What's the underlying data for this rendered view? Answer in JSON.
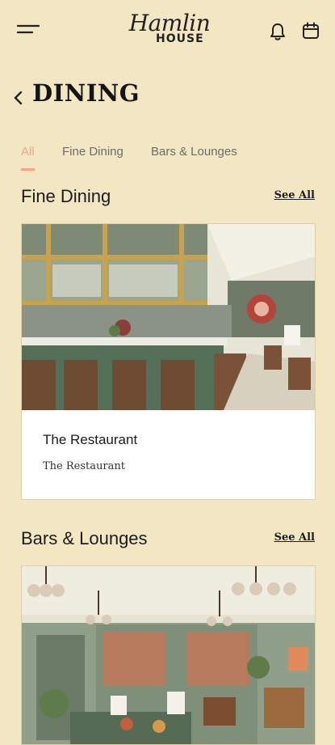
{
  "header": {
    "logo_script": "Hamlin",
    "logo_caps": "HOUSE"
  },
  "page": {
    "title": "DINING"
  },
  "tabs": [
    {
      "label": "All",
      "active": true
    },
    {
      "label": "Fine Dining",
      "active": false
    },
    {
      "label": "Bars & Lounges",
      "active": false
    }
  ],
  "sections": [
    {
      "title": "Fine Dining",
      "see_all": "See All",
      "cards": [
        {
          "title": "The Restaurant",
          "subtitle": "The Restaurant"
        }
      ]
    },
    {
      "title": "Bars & Lounges",
      "see_all": "See All"
    }
  ],
  "colors": {
    "background": "#f3e7c3",
    "accent": "#f0a58a",
    "text": "#1c1c1c"
  },
  "icons": [
    "menu-icon",
    "bell-icon",
    "calendar-icon",
    "back-chevron-icon"
  ]
}
